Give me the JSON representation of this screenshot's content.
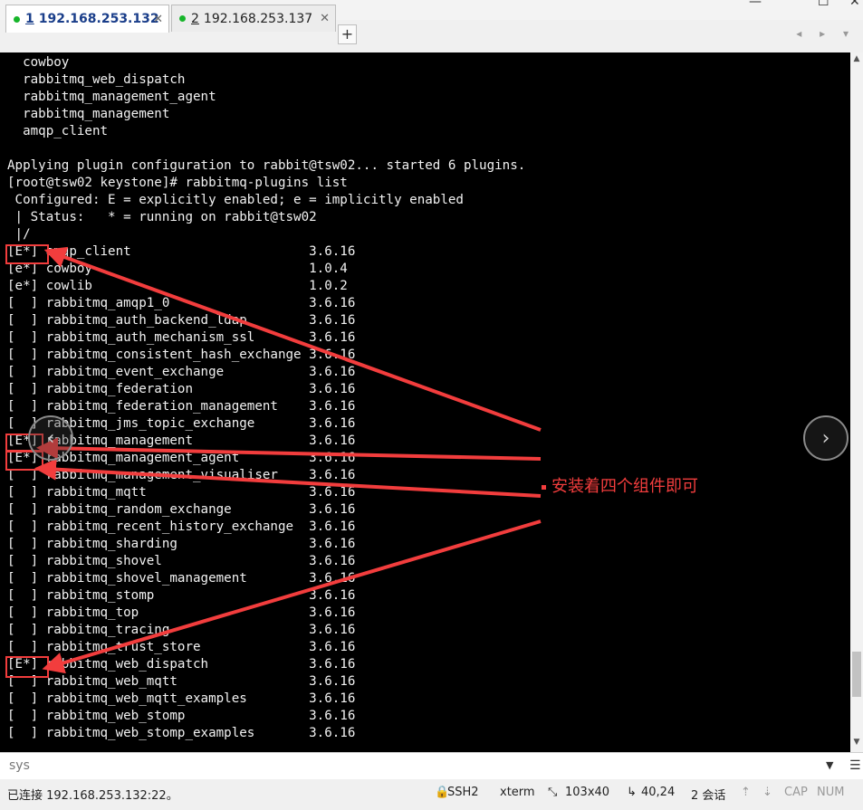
{
  "window": {
    "minimize": "—",
    "maximize": "☐",
    "close": "✕"
  },
  "tabs": [
    {
      "num": "1",
      "label": "192.168.253.132",
      "active": true
    },
    {
      "num": "2",
      "label": "192.168.253.137",
      "active": false
    }
  ],
  "add_tab": "+",
  "tab_nav": "◂ ▸ ▾",
  "terminal": {
    "lines": [
      "  cowboy",
      "  rabbitmq_web_dispatch",
      "  rabbitmq_management_agent",
      "  rabbitmq_management",
      "  amqp_client",
      "",
      "Applying plugin configuration to rabbit@tsw02... started 6 plugins.",
      "[root@tsw02 keystone]# rabbitmq-plugins list",
      " Configured: E = explicitly enabled; e = implicitly enabled",
      " | Status:   * = running on rabbit@tsw02",
      " |/",
      "[E*] amqp_client                       3.6.16",
      "[e*] cowboy                            1.0.4",
      "[e*] cowlib                            1.0.2",
      "[  ] rabbitmq_amqp1_0                  3.6.16",
      "[  ] rabbitmq_auth_backend_ldap        3.6.16",
      "[  ] rabbitmq_auth_mechanism_ssl       3.6.16",
      "[  ] rabbitmq_consistent_hash_exchange 3.6.16",
      "[  ] rabbitmq_event_exchange           3.6.16",
      "[  ] rabbitmq_federation               3.6.16",
      "[  ] rabbitmq_federation_management    3.6.16",
      "[  ] rabbitmq_jms_topic_exchange       3.6.16",
      "[E*] rabbitmq_management               3.6.16",
      "[E*] rabbitmq_management_agent         3.6.16",
      "[  ] rabbitmq_management_visualiser    3.6.16",
      "[  ] rabbitmq_mqtt                     3.6.16",
      "[  ] rabbitmq_random_exchange          3.6.16",
      "[  ] rabbitmq_recent_history_exchange  3.6.16",
      "[  ] rabbitmq_sharding                 3.6.16",
      "[  ] rabbitmq_shovel                   3.6.16",
      "[  ] rabbitmq_shovel_management        3.6.16",
      "[  ] rabbitmq_stomp                    3.6.16",
      "[  ] rabbitmq_top                      3.6.16",
      "[  ] rabbitmq_tracing                  3.6.16",
      "[  ] rabbitmq_trust_store              3.6.16",
      "[E*] rabbitmq_web_dispatch             3.6.16",
      "[  ] rabbitmq_web_mqtt                 3.6.16",
      "[  ] rabbitmq_web_mqtt_examples        3.6.16",
      "[  ] rabbitmq_web_stomp                3.6.16",
      "[  ] rabbitmq_web_stomp_examples       3.6.16"
    ]
  },
  "annotation": {
    "text": "安装着四个组件即可",
    "color": "#f23d3d"
  },
  "nav_buttons": {
    "prev": "‹",
    "next": "›"
  },
  "input_bar": {
    "value": "sys",
    "dropdown": "▼",
    "menu": "☰"
  },
  "status_bar": {
    "connection": "已连接 192.168.253.132:22。",
    "protocol": "SSH2",
    "terminal_type": "xterm",
    "size": "103x40",
    "cursor": "40,24",
    "sessions": "2 会话",
    "caps": "CAP",
    "num": "NUM"
  },
  "colors": {
    "terminal_bg": "#000000",
    "terminal_fg": "#f2f2f2",
    "active_tab_text": "#1a3e8a",
    "status_dot": "#16b52a"
  }
}
